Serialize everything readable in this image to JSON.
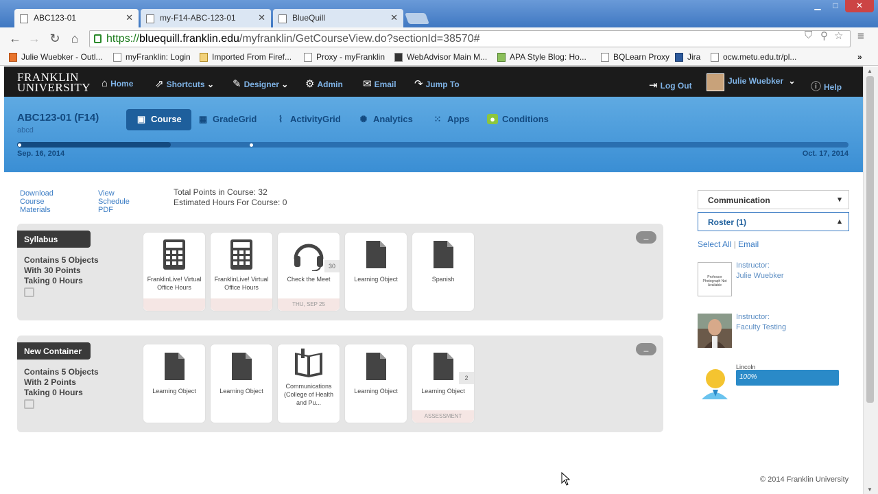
{
  "browser": {
    "tabs": [
      {
        "label": "ABC123-01",
        "active": true
      },
      {
        "label": "my-F14-ABC-123-01",
        "active": false
      },
      {
        "label": "BlueQuill",
        "active": false
      }
    ],
    "url_scheme": "https://",
    "url_host": "bluequill.franklin.edu",
    "url_path": "/myfranklin/GetCourseView.do?sectionId=38570#",
    "bookmarks": [
      "Julie Wuebker - Outl...",
      "myFranklin: Login",
      "Imported From Firef...",
      "Proxy - myFranklin",
      "WebAdvisor Main M...",
      "APA Style Blog: Ho...",
      "BQLearn Proxy",
      "Jira",
      "ocw.metu.edu.tr/pl..."
    ]
  },
  "site": {
    "logo_line1": "FRANKLIN",
    "logo_line2": "UNIVERSITY",
    "nav": {
      "home": "Home",
      "shortcuts": "Shortcuts",
      "designer": "Designer",
      "admin": "Admin",
      "email": "Email",
      "jump_to": "Jump To",
      "log_out": "Log Out",
      "user": "Julie Wuebker",
      "help": "Help"
    }
  },
  "course": {
    "title": "ABC123-01 (F14)",
    "subtitle": "abcd",
    "tabs": {
      "course": "Course",
      "gradegrid": "GradeGrid",
      "activitygrid": "ActivityGrid",
      "analytics": "Analytics",
      "apps": "Apps",
      "conditions": "Conditions"
    },
    "start_date": "Sep. 16, 2014",
    "end_date": "Oct. 17, 2014",
    "timeline_progress": 0.185
  },
  "links": {
    "download": [
      "Download",
      "Course",
      "Materials"
    ],
    "schedule": [
      "View",
      "Schedule",
      "PDF"
    ]
  },
  "summary": {
    "total_points": "Total Points in Course: 32",
    "estimated_hours": "Estimated Hours For Course: 0"
  },
  "containers": [
    {
      "title": "Syllabus",
      "desc": [
        "Contains 5 Objects",
        "With 30 Points",
        "Taking 0 Hours"
      ],
      "collapse_label": "_",
      "items": [
        {
          "label": "FranklinLive! Virtual Office Hours",
          "icon": "calculator-icon",
          "badge": "",
          "footer": ""
        },
        {
          "label": "FranklinLive! Virtual Office Hours",
          "icon": "calculator-icon",
          "badge": "",
          "footer": ""
        },
        {
          "label": "Check the Meet",
          "icon": "headset-icon",
          "badge": "30",
          "footer": "THU, SEP 25"
        },
        {
          "label": "Learning Object",
          "icon": "document-icon",
          "badge": "",
          "footer": ""
        },
        {
          "label": "Spanish",
          "icon": "document-icon",
          "badge": "",
          "footer": ""
        }
      ]
    },
    {
      "title": "New Container",
      "desc": [
        "Contains 5 Objects",
        "With 2 Points",
        "Taking 0 Hours"
      ],
      "collapse_label": "_",
      "items": [
        {
          "label": "Learning Object",
          "icon": "document-icon",
          "badge": "",
          "footer": ""
        },
        {
          "label": "Learning Object",
          "icon": "document-icon",
          "badge": "",
          "footer": ""
        },
        {
          "label": "Communications (College of Health and Pu...",
          "icon": "book-icon",
          "badge": "",
          "footer": ""
        },
        {
          "label": "Learning Object",
          "icon": "document-icon",
          "badge": "",
          "footer": ""
        },
        {
          "label": "Learning Object",
          "icon": "document-icon",
          "badge": "2",
          "footer": "ASSESSMENT"
        }
      ]
    }
  ],
  "sidebar": {
    "communication": "Communication",
    "roster": "Roster (1)",
    "select_all": "Select All",
    "separator": "|",
    "email": "Email",
    "placeholder_photo": "Professor Photograph Not Available",
    "members": [
      {
        "role": "Instructor:",
        "name": "Julie Wuebker"
      },
      {
        "role": "Instructor:",
        "name": "Faculty Testing"
      }
    ],
    "student_name": "Lincoln",
    "student_progress_label": "100%"
  },
  "footer": "© 2014 Franklin University",
  "colors": {
    "nav_bg": "#1b1b1b",
    "banner": "#4a9edc",
    "accent": "#1e5f9c",
    "link": "#3b7cc4"
  }
}
